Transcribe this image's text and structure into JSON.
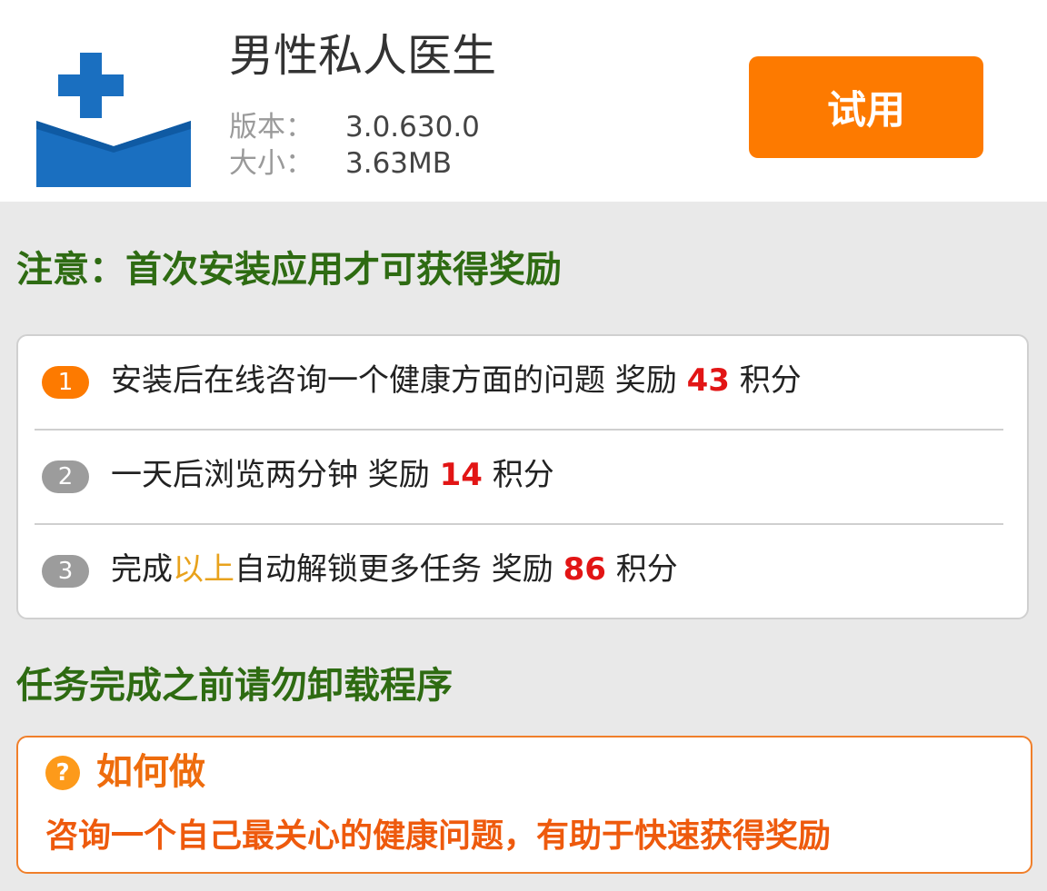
{
  "app": {
    "name": "男性私人医生",
    "version_label": "版本：",
    "version": "3.0.630.0",
    "size_label": "大小：",
    "size": "3.63MB",
    "try_button": "试用",
    "icon": "medical-envelope-icon",
    "brand_color": "#1a6fc0",
    "accent_color": "#fd7a00"
  },
  "notice": "注意：首次安装应用才可获得奖励",
  "tasks": [
    {
      "num": "1",
      "text": "安装后在线咨询一个健康方面的问题 奖励 ",
      "points": "43",
      "unit": " 积分"
    },
    {
      "num": "2",
      "text": "一天后浏览两分钟 奖励 ",
      "points": "14",
      "unit": " 积分"
    },
    {
      "num": "3",
      "text_before": "完成",
      "highlight": "以上",
      "text_after": "自动解锁更多任务 奖励 ",
      "points": "86",
      "unit": " 积分"
    }
  ],
  "warning": "任务完成之前请勿卸载程序",
  "how_to": {
    "icon_glyph": "?",
    "title": "如何做",
    "text": "咨询一个自己最关心的健康问题，有助于快速获得奖励"
  }
}
